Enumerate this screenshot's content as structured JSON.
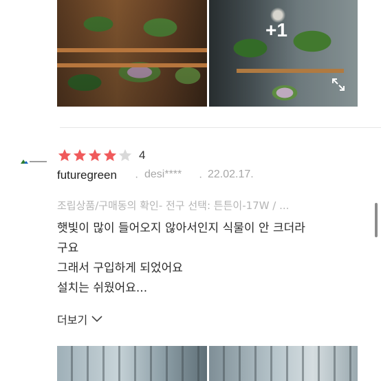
{
  "photos": {
    "extra_count_label": "+1"
  },
  "review": {
    "rating": "4",
    "stars_filled": 4,
    "stars_total": 5,
    "reviewer": "futuregreen",
    "user_id": "desi****",
    "date": "22.02.17.",
    "option": "조립상품/구매동의 확인- 전구 선택: 튼튼이-17W / ...",
    "content_lines": [
      "햇빛이 많이 들어오지 않아서인지 식물이 안 크더라",
      "구요",
      "그래서 구입하게 되었어요",
      "설치는 쉬웠어요..."
    ],
    "more_label": "더보기"
  },
  "colors": {
    "star_filled": "#f05a5b",
    "star_empty": "#d9d9d9"
  }
}
